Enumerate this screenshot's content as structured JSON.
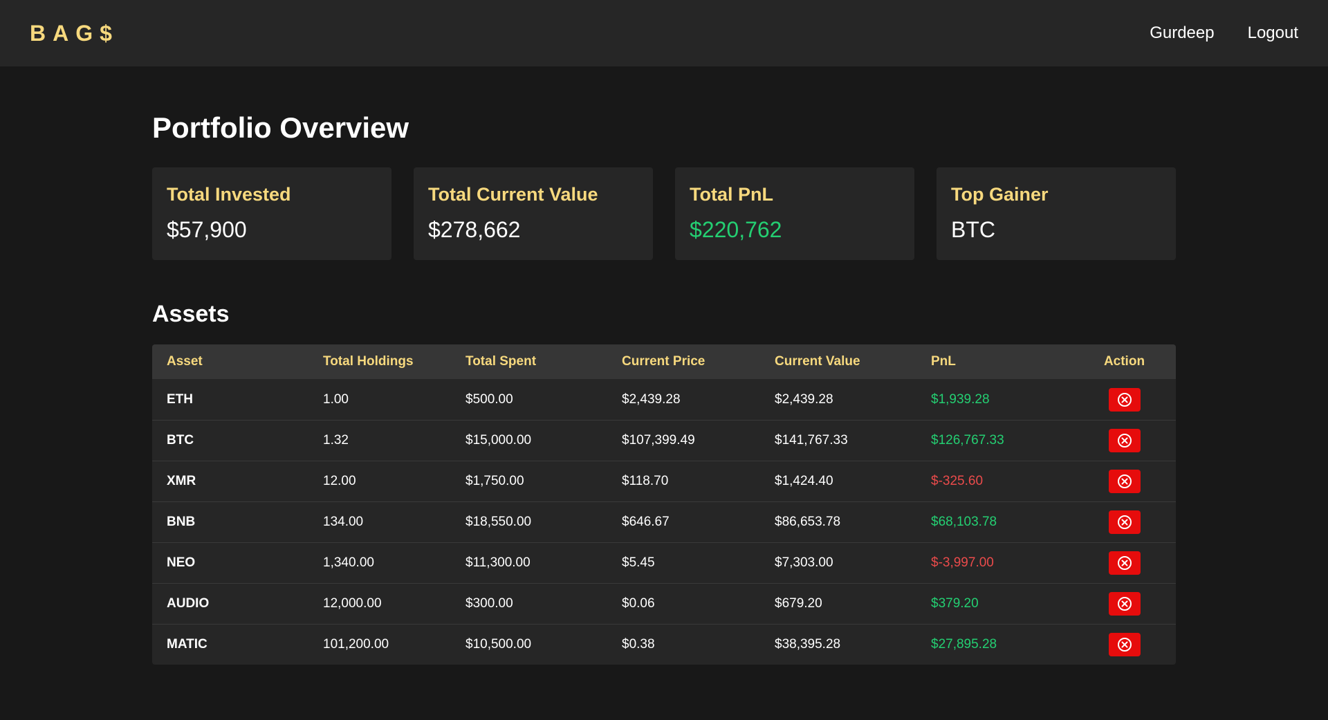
{
  "nav": {
    "brand": "BAG$",
    "user": "Gurdeep",
    "logout": "Logout"
  },
  "page": {
    "title": "Portfolio Overview"
  },
  "summary": {
    "total_invested": {
      "label": "Total Invested",
      "value": "$57,900"
    },
    "total_current_value": {
      "label": "Total Current Value",
      "value": "$278,662"
    },
    "total_pnl": {
      "label": "Total PnL",
      "value": "$220,762"
    },
    "top_gainer": {
      "label": "Top Gainer",
      "value": "BTC"
    }
  },
  "assets": {
    "title": "Assets",
    "columns": [
      "Asset",
      "Total Holdings",
      "Total Spent",
      "Current Price",
      "Current Value",
      "PnL",
      "Action"
    ],
    "rows": [
      {
        "asset": "ETH",
        "holdings": "1.00",
        "spent": "$500.00",
        "price": "$2,439.28",
        "value": "$2,439.28",
        "pnl": "$1,939.28",
        "pnl_positive": true
      },
      {
        "asset": "BTC",
        "holdings": "1.32",
        "spent": "$15,000.00",
        "price": "$107,399.49",
        "value": "$141,767.33",
        "pnl": "$126,767.33",
        "pnl_positive": true
      },
      {
        "asset": "XMR",
        "holdings": "12.00",
        "spent": "$1,750.00",
        "price": "$118.70",
        "value": "$1,424.40",
        "pnl": "$-325.60",
        "pnl_positive": false
      },
      {
        "asset": "BNB",
        "holdings": "134.00",
        "spent": "$18,550.00",
        "price": "$646.67",
        "value": "$86,653.78",
        "pnl": "$68,103.78",
        "pnl_positive": true
      },
      {
        "asset": "NEO",
        "holdings": "1,340.00",
        "spent": "$11,300.00",
        "price": "$5.45",
        "value": "$7,303.00",
        "pnl": "$-3,997.00",
        "pnl_positive": false
      },
      {
        "asset": "AUDIO",
        "holdings": "12,000.00",
        "spent": "$300.00",
        "price": "$0.06",
        "value": "$679.20",
        "pnl": "$379.20",
        "pnl_positive": true
      },
      {
        "asset": "MATIC",
        "holdings": "101,200.00",
        "spent": "$10,500.00",
        "price": "$0.38",
        "value": "$38,395.28",
        "pnl": "$27,895.28",
        "pnl_positive": true
      }
    ],
    "action_icon": "remove-circle-icon"
  },
  "colors": {
    "accent": "#f7d97e",
    "positive": "#24cf72",
    "negative": "#ea4b4b",
    "danger_button": "#e60c0c",
    "background": "#181818",
    "surface": "#262626"
  }
}
